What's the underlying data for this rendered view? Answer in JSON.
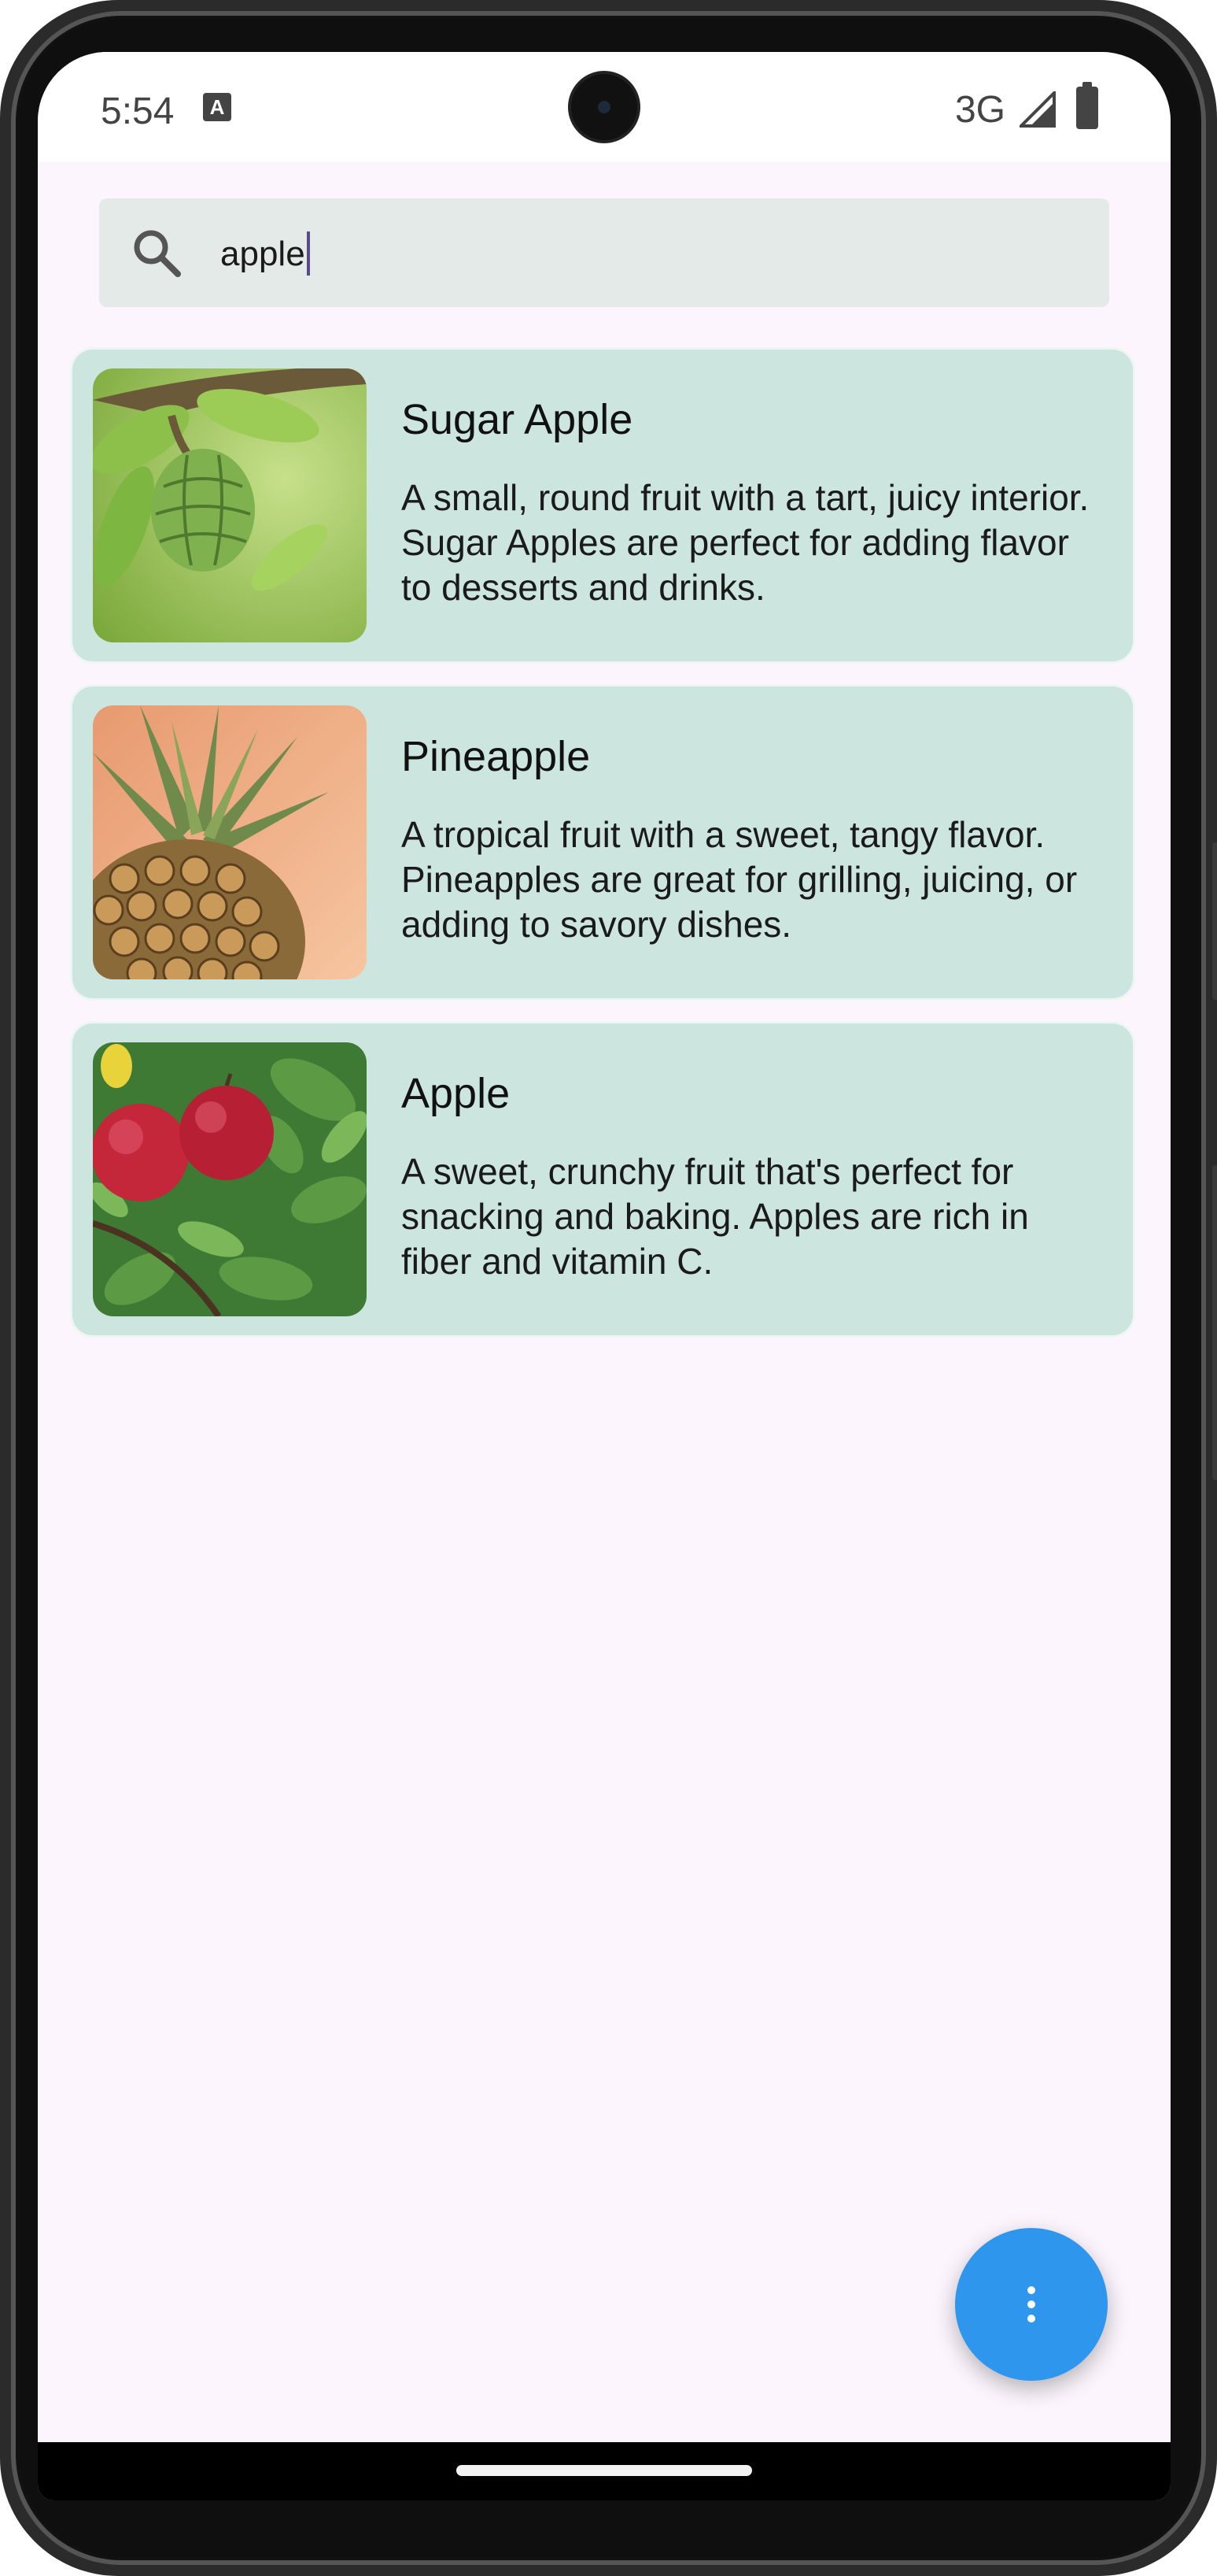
{
  "status_bar": {
    "time": "5:54",
    "notification_icon": "A",
    "network": "3G",
    "icons": [
      "signal-icon",
      "battery-icon"
    ]
  },
  "search": {
    "value": "apple",
    "icon": "search-icon"
  },
  "results": [
    {
      "title": "Sugar Apple",
      "description": "A small, round fruit with a tart, juicy interior. Sugar Apples are perfect for adding flavor to desserts and drinks.",
      "image": "sugar-apple-photo"
    },
    {
      "title": "Pineapple",
      "description": "A tropical fruit with a sweet, tangy flavor. Pineapples are great for grilling, juicing, or adding to savory dishes.",
      "image": "pineapple-photo"
    },
    {
      "title": "Apple",
      "description": "A sweet, crunchy fruit that's perfect for snacking and baking. Apples are rich in fiber and vitamin C.",
      "image": "apple-photo"
    }
  ],
  "fab": {
    "icon": "more-vert-icon"
  },
  "colors": {
    "background": "#fcf5fd",
    "card": "#cce6df",
    "search_bar": "#e3eae8",
    "fab": "#2f96ee"
  }
}
